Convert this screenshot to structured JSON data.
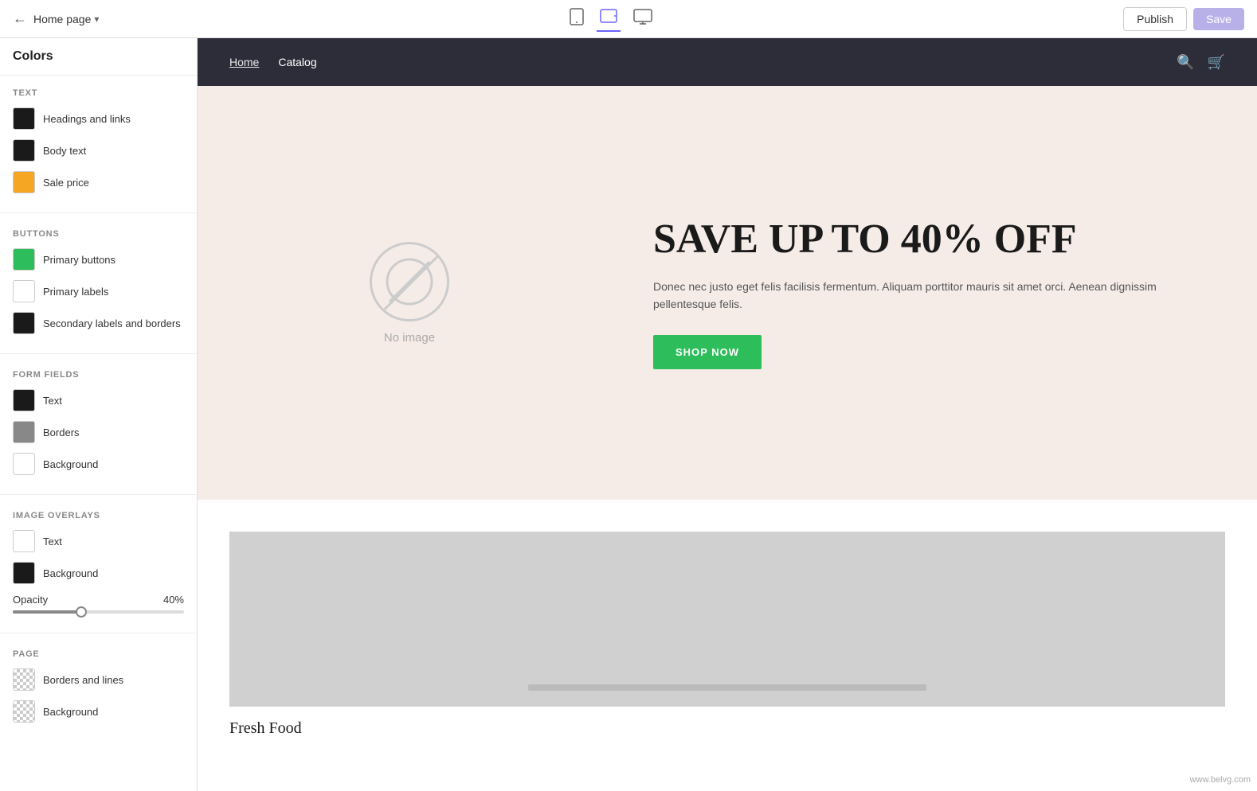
{
  "topbar": {
    "back_icon": "←",
    "page_label": "Home page",
    "chevron": "▾",
    "view_mobile_icon": "📱",
    "view_tablet_icon": "⬜",
    "view_desktop_icon": "⬛",
    "publish_label": "Publish",
    "save_label": "Save"
  },
  "sidebar": {
    "title": "Colors",
    "sections": {
      "text": {
        "label": "TEXT",
        "items": [
          {
            "id": "headings-links",
            "label": "Headings and links",
            "color": "#1a1a1a",
            "transparent": false
          },
          {
            "id": "body-text",
            "label": "Body text",
            "color": "#1a1a1a",
            "transparent": false
          },
          {
            "id": "sale-price",
            "label": "Sale price",
            "color": "#f5a623",
            "transparent": false
          }
        ]
      },
      "buttons": {
        "label": "BUTTONS",
        "items": [
          {
            "id": "primary-buttons",
            "label": "Primary buttons",
            "color": "#2dbd5a",
            "transparent": false
          },
          {
            "id": "primary-labels",
            "label": "Primary labels",
            "color": "#ffffff",
            "transparent": false
          },
          {
            "id": "secondary-labels-borders",
            "label": "Secondary labels and borders",
            "color": "#1a1a1a",
            "transparent": false
          }
        ]
      },
      "form_fields": {
        "label": "FORM FIELDS",
        "items": [
          {
            "id": "form-text",
            "label": "Text",
            "color": "#1a1a1a",
            "transparent": false
          },
          {
            "id": "form-borders",
            "label": "Borders",
            "color": "#888888",
            "transparent": false
          },
          {
            "id": "form-background",
            "label": "Background",
            "color": "#ffffff",
            "transparent": false
          }
        ]
      },
      "image_overlays": {
        "label": "IMAGE OVERLAYS",
        "items": [
          {
            "id": "overlay-text",
            "label": "Text",
            "color": "#ffffff",
            "transparent": false
          },
          {
            "id": "overlay-background",
            "label": "Background",
            "color": "#1a1a1a",
            "transparent": false
          }
        ],
        "opacity": {
          "label": "Opacity",
          "value": "40%",
          "percent": 40
        }
      },
      "page": {
        "label": "PAGE",
        "items": [
          {
            "id": "page-borders",
            "label": "Borders and lines",
            "color": "transparent",
            "transparent": true
          },
          {
            "id": "page-background",
            "label": "Background",
            "color": "transparent",
            "transparent": true
          }
        ]
      }
    }
  },
  "preview": {
    "nav": {
      "links": [
        "Home",
        "Catalog"
      ],
      "active_link": "Home"
    },
    "hero": {
      "no_image_text": "No image",
      "title": "SAVE UP TO 40% OFF",
      "subtitle": "Donec nec justo eget felis facilisis fermentum. Aliquam porttitor mauris sit amet orci. Aenean dignissim pellentesque felis.",
      "button_label": "SHOP NOW"
    },
    "products": {
      "title": "Fresh Food"
    },
    "watermark": "www.belvg.com"
  }
}
